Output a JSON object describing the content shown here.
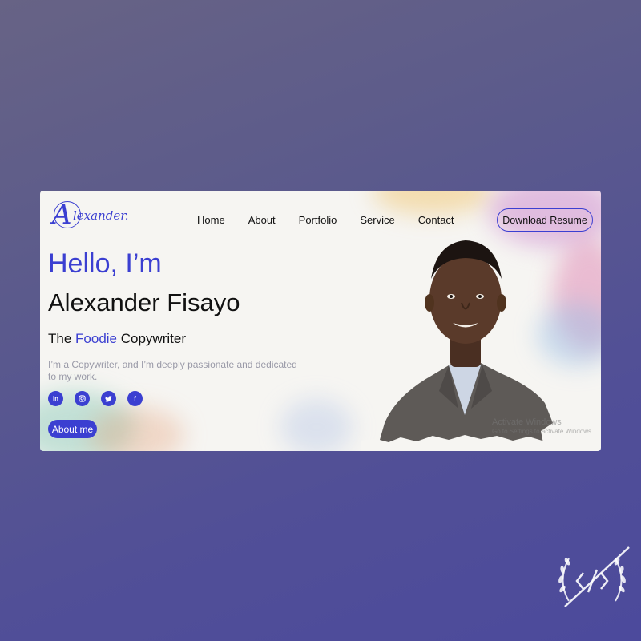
{
  "logo": {
    "initial": "A",
    "rest": "lexander."
  },
  "nav": {
    "items": [
      {
        "label": "Home"
      },
      {
        "label": "About"
      },
      {
        "label": "Portfolio"
      },
      {
        "label": "Service"
      },
      {
        "label": "Contact"
      }
    ],
    "resume_button": "Download Resume"
  },
  "hero": {
    "greeting": "Hello, I’m",
    "name": "Alexander Fisayo",
    "role_prefix": "The",
    "role_highlight": "Foodie",
    "role_suffix": "Copywriter",
    "description": "I’m a Copywriter, and I’m deeply passionate and dedicated to my work.",
    "about_button": "About me"
  },
  "socials": [
    {
      "icon": "linkedin-icon",
      "glyph": "in"
    },
    {
      "icon": "instagram-icon",
      "glyph": "◎"
    },
    {
      "icon": "twitter-icon",
      "glyph": "🐦"
    },
    {
      "icon": "facebook-icon",
      "glyph": "f"
    }
  ],
  "os_watermark": {
    "line1": "Activate Windows",
    "line2": "Go to Settings to activate Windows."
  },
  "colors": {
    "accent": "#3b3fd1",
    "background": "#4f4e98",
    "card": "#f6f5f2"
  }
}
